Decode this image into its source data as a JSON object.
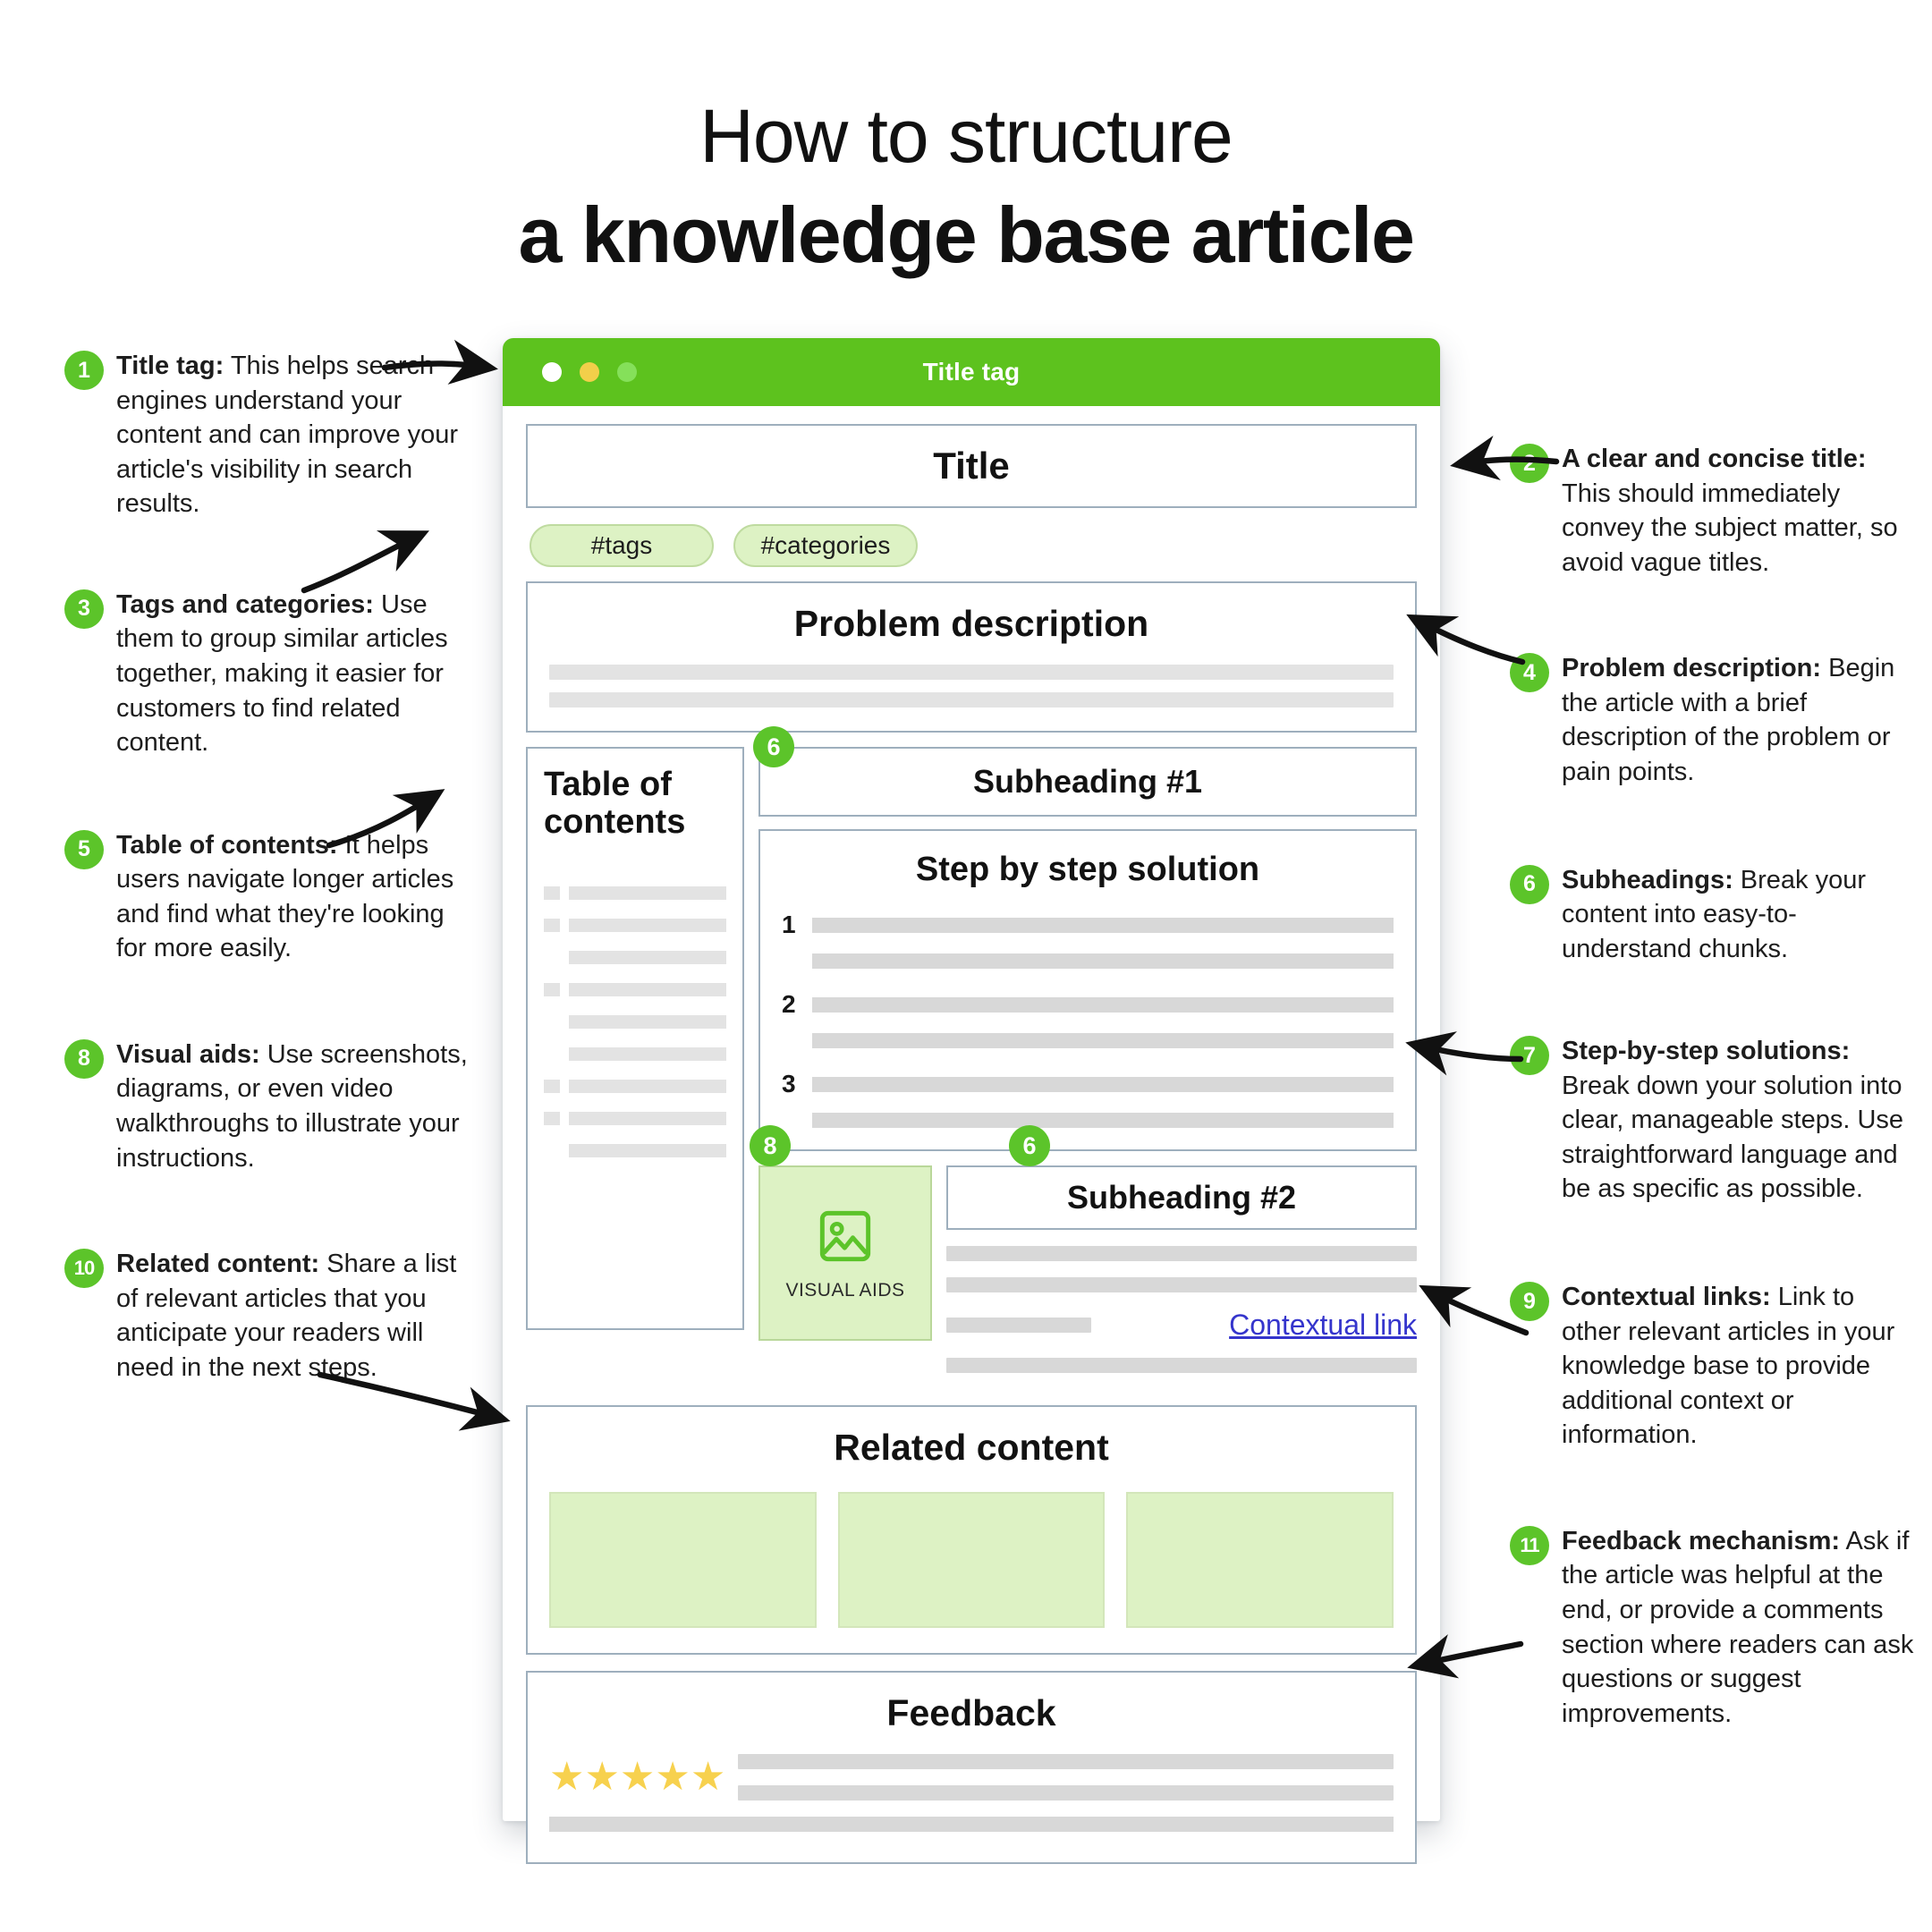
{
  "heading": {
    "line1": "How to structure",
    "line2": "a knowledge base article"
  },
  "colors": {
    "accent_green": "#5cc42a",
    "titlebar_green": "#5dc21e",
    "chip_green": "#ddf2c4",
    "link_blue": "#3535cc",
    "star_yellow": "#f7d14e",
    "placeholder_gray": "#e3e3e3"
  },
  "annotations_left": [
    {
      "number": "1",
      "lead": "Title tag:",
      "body": " This helps search engines understand your content and can improve your article's visibility in search results."
    },
    {
      "number": "3",
      "lead": "Tags and categories:",
      "body": " Use them to group similar articles together, making it easier for customers to find related content."
    },
    {
      "number": "5",
      "lead": "Table of contents:",
      "body": " It helps users navigate longer articles and find what they're looking for more easily."
    },
    {
      "number": "8",
      "lead": "Visual aids:",
      "body": " Use screenshots, diagrams, or even video walkthroughs to illustrate your instructions."
    },
    {
      "number": "10",
      "lead": "Related content:",
      "body": " Share a list of relevant articles that you anticipate your readers will need in the next steps."
    }
  ],
  "annotations_right": [
    {
      "number": "2",
      "lead": "A clear and concise title:",
      "body": " This should immediately convey the subject matter, so avoid vague titles."
    },
    {
      "number": "4",
      "lead": "Problem description:",
      "body": " Begin the article with a brief description of the problem or pain points."
    },
    {
      "number": "6",
      "lead": "Subheadings:",
      "body": " Break your content into easy-to-understand chunks."
    },
    {
      "number": "7",
      "lead": "Step-by-step solutions:",
      "body": " Break down your solution into clear, manageable steps. Use straightforward language and be as specific as possible."
    },
    {
      "number": "9",
      "lead": "Contextual links:",
      "body": " Link to other relevant articles in your knowledge base to provide additional context or information."
    },
    {
      "number": "11",
      "lead": "Feedback mechanism:",
      "body": " Ask if the article was helpful at the end, or provide a comments section where readers can ask questions or suggest improvements."
    }
  ],
  "mockup": {
    "titlebar": {
      "label": "Title tag",
      "dots": [
        "white-dot",
        "yellow-dot",
        "green-dot"
      ]
    },
    "article_title": "Title",
    "chips": [
      "#tags",
      "#categories"
    ],
    "problem": {
      "title": "Problem description",
      "line_count": 2
    },
    "toc": {
      "title": "Table of contents",
      "rows": [
        {
          "bullet": true
        },
        {
          "bullet": true
        },
        {
          "bullet": false
        },
        {
          "bullet": true
        },
        {
          "bullet": false
        },
        {
          "bullet": false
        },
        {
          "bullet": true
        },
        {
          "bullet": true
        },
        {
          "bullet": false
        }
      ]
    },
    "subheading_1": "Subheading #1",
    "steps": {
      "title": "Step by step solution",
      "numbers": [
        "1",
        "2",
        "3"
      ]
    },
    "visual_aids": {
      "label": "VISUAL AIDS",
      "icon": "image-icon"
    },
    "subheading_2": "Subheading #2",
    "contextual_link": "Contextual link",
    "related": {
      "title": "Related content",
      "card_count": 3
    },
    "feedback": {
      "title": "Feedback",
      "stars": 5,
      "star_glyph": "★"
    },
    "pins": {
      "subheading_1": "6",
      "visual_aids": "8",
      "subheading_2": "6"
    }
  }
}
